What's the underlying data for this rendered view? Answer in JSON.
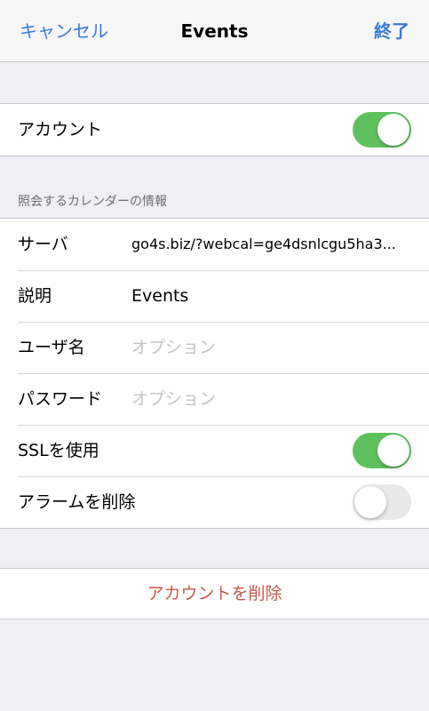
{
  "nav": {
    "cancel_label": "キャンセル",
    "title": "Events",
    "done_label": "終了"
  },
  "account": {
    "label": "アカウント",
    "enabled": true
  },
  "section_header": "照会するカレンダーの情報",
  "fields": {
    "server_label": "サーバ",
    "server_value": "go4s.biz/?webcal=ge4dsnlcgu5ha3...",
    "description_label": "説明",
    "description_value": "Events",
    "username_label": "ユーザ名",
    "username_placeholder": "オプション",
    "password_label": "パスワード",
    "password_placeholder": "オプション",
    "ssl_label": "SSLを使用",
    "ssl_enabled": true,
    "remove_alarms_label": "アラームを削除",
    "remove_alarms_enabled": false
  },
  "delete_account_label": "アカウントを削除",
  "colors": {
    "accent": "#3a7bd5",
    "toggle_on": "#5fc15e",
    "destructive": "#c9584c"
  }
}
